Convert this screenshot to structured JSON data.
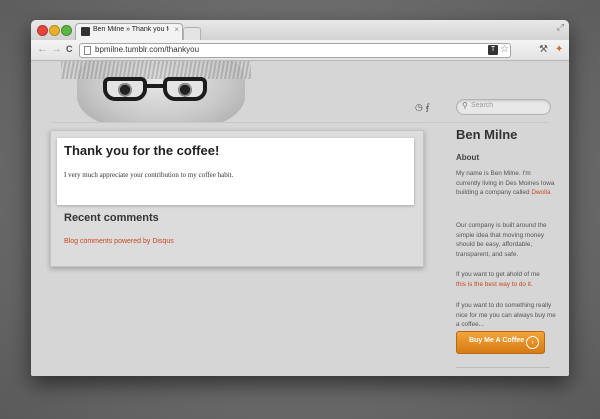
{
  "browser": {
    "tab_title": "Ben Milne » Thank you for th...",
    "url": "bpmilne.tumblr.com/thankyou",
    "back_icon": "←",
    "forward_icon": "→",
    "reload_icon": "C",
    "ext_icon_label": "T",
    "star_icon": "☆",
    "wrench_icon": "⚒",
    "extra_icon": "✦",
    "resize_icon": "⤢"
  },
  "header": {
    "feed_icons": "◷ ⨐",
    "search": {
      "icon": "⚲",
      "placeholder": "Search"
    }
  },
  "post": {
    "title": "Thank you for the coffee!",
    "body": "I very much appreciate your contribution to my coffee habit."
  },
  "comments": {
    "title": "Recent comments",
    "link": "Blog comments powered by Disqus"
  },
  "sidebar": {
    "name": "Ben Milne",
    "about_heading": "About",
    "p1_text": "My name is Ben Milne. I'm currently living in Des Moines Iowa building a company called",
    "p1_link": "Dwolla",
    "p2": "Our company is built around the simple idea that moving money should be easy, affordable, transparent, and safe.",
    "p3_text": "If you want to get ahold of me",
    "p3_link": "this is the best way to do it.",
    "p4": "If you want to do something really nice for me you can always buy me a coffee...",
    "button_label": "Buy Me A Coffee",
    "button_arrow": "›"
  },
  "colors": {
    "link": "#c9481d",
    "button": "#e68f22"
  }
}
